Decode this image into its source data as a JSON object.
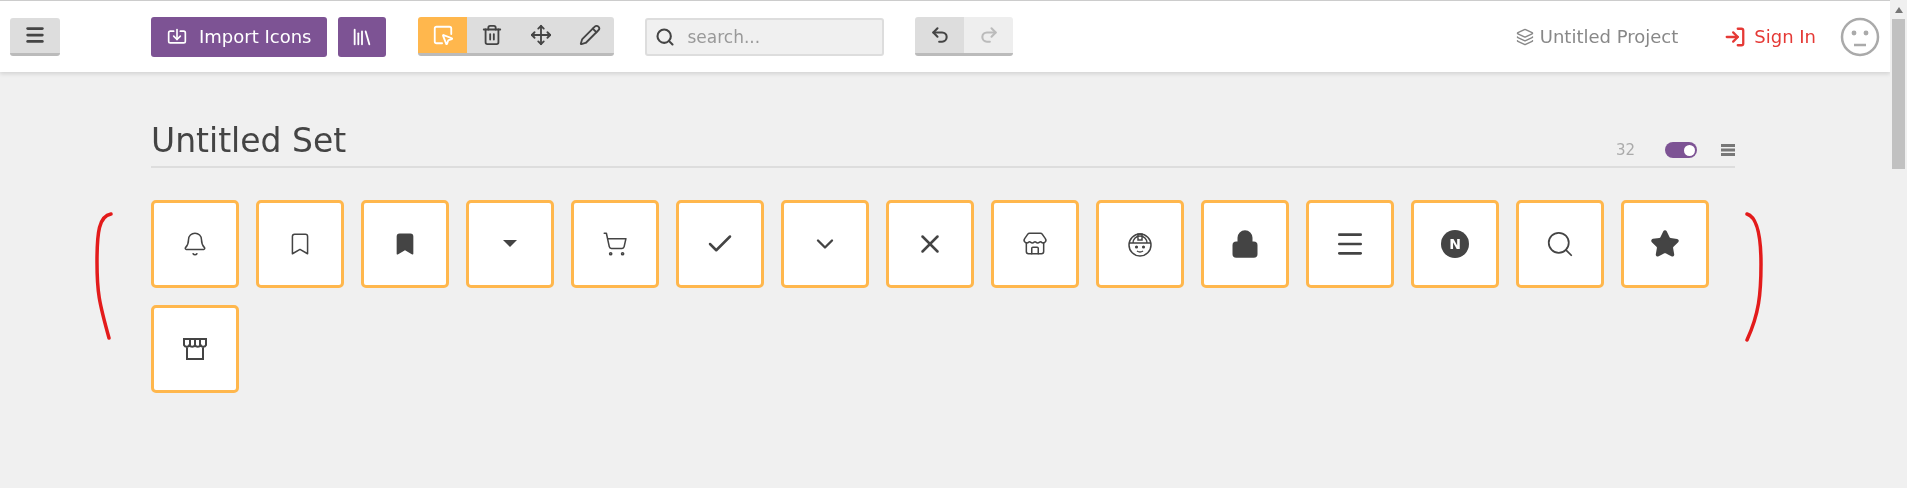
{
  "header": {
    "import_button": "Import Icons",
    "tools": [
      {
        "kind": "select",
        "selected": true
      },
      {
        "kind": "delete",
        "selected": false
      },
      {
        "kind": "move",
        "selected": false
      },
      {
        "kind": "edit",
        "selected": false
      }
    ],
    "search": {
      "placeholder": "search..."
    },
    "history": [
      {
        "kind": "undo",
        "disabled": false
      },
      {
        "kind": "redo",
        "disabled": true
      }
    ],
    "project": "Untitled Project",
    "sign_in": "Sign In"
  },
  "set": {
    "title": "Untitled Set",
    "count": "32",
    "toggle_on": true,
    "icons": [
      {
        "kind": "bell",
        "selected": true
      },
      {
        "kind": "bookmark-outline",
        "selected": true
      },
      {
        "kind": "bookmark-filled",
        "selected": true
      },
      {
        "kind": "caret-down",
        "selected": true
      },
      {
        "kind": "cart",
        "selected": true
      },
      {
        "kind": "check",
        "selected": true
      },
      {
        "kind": "chevron-down",
        "selected": true
      },
      {
        "kind": "close",
        "selected": true
      },
      {
        "kind": "shop",
        "selected": true
      },
      {
        "kind": "worker",
        "selected": true
      },
      {
        "kind": "lock",
        "selected": true
      },
      {
        "kind": "menu",
        "selected": true
      },
      {
        "kind": "letter-badge",
        "letter": "N",
        "selected": true
      },
      {
        "kind": "search",
        "selected": true
      },
      {
        "kind": "star",
        "selected": true
      },
      {
        "kind": "storefront",
        "selected": true
      }
    ]
  }
}
